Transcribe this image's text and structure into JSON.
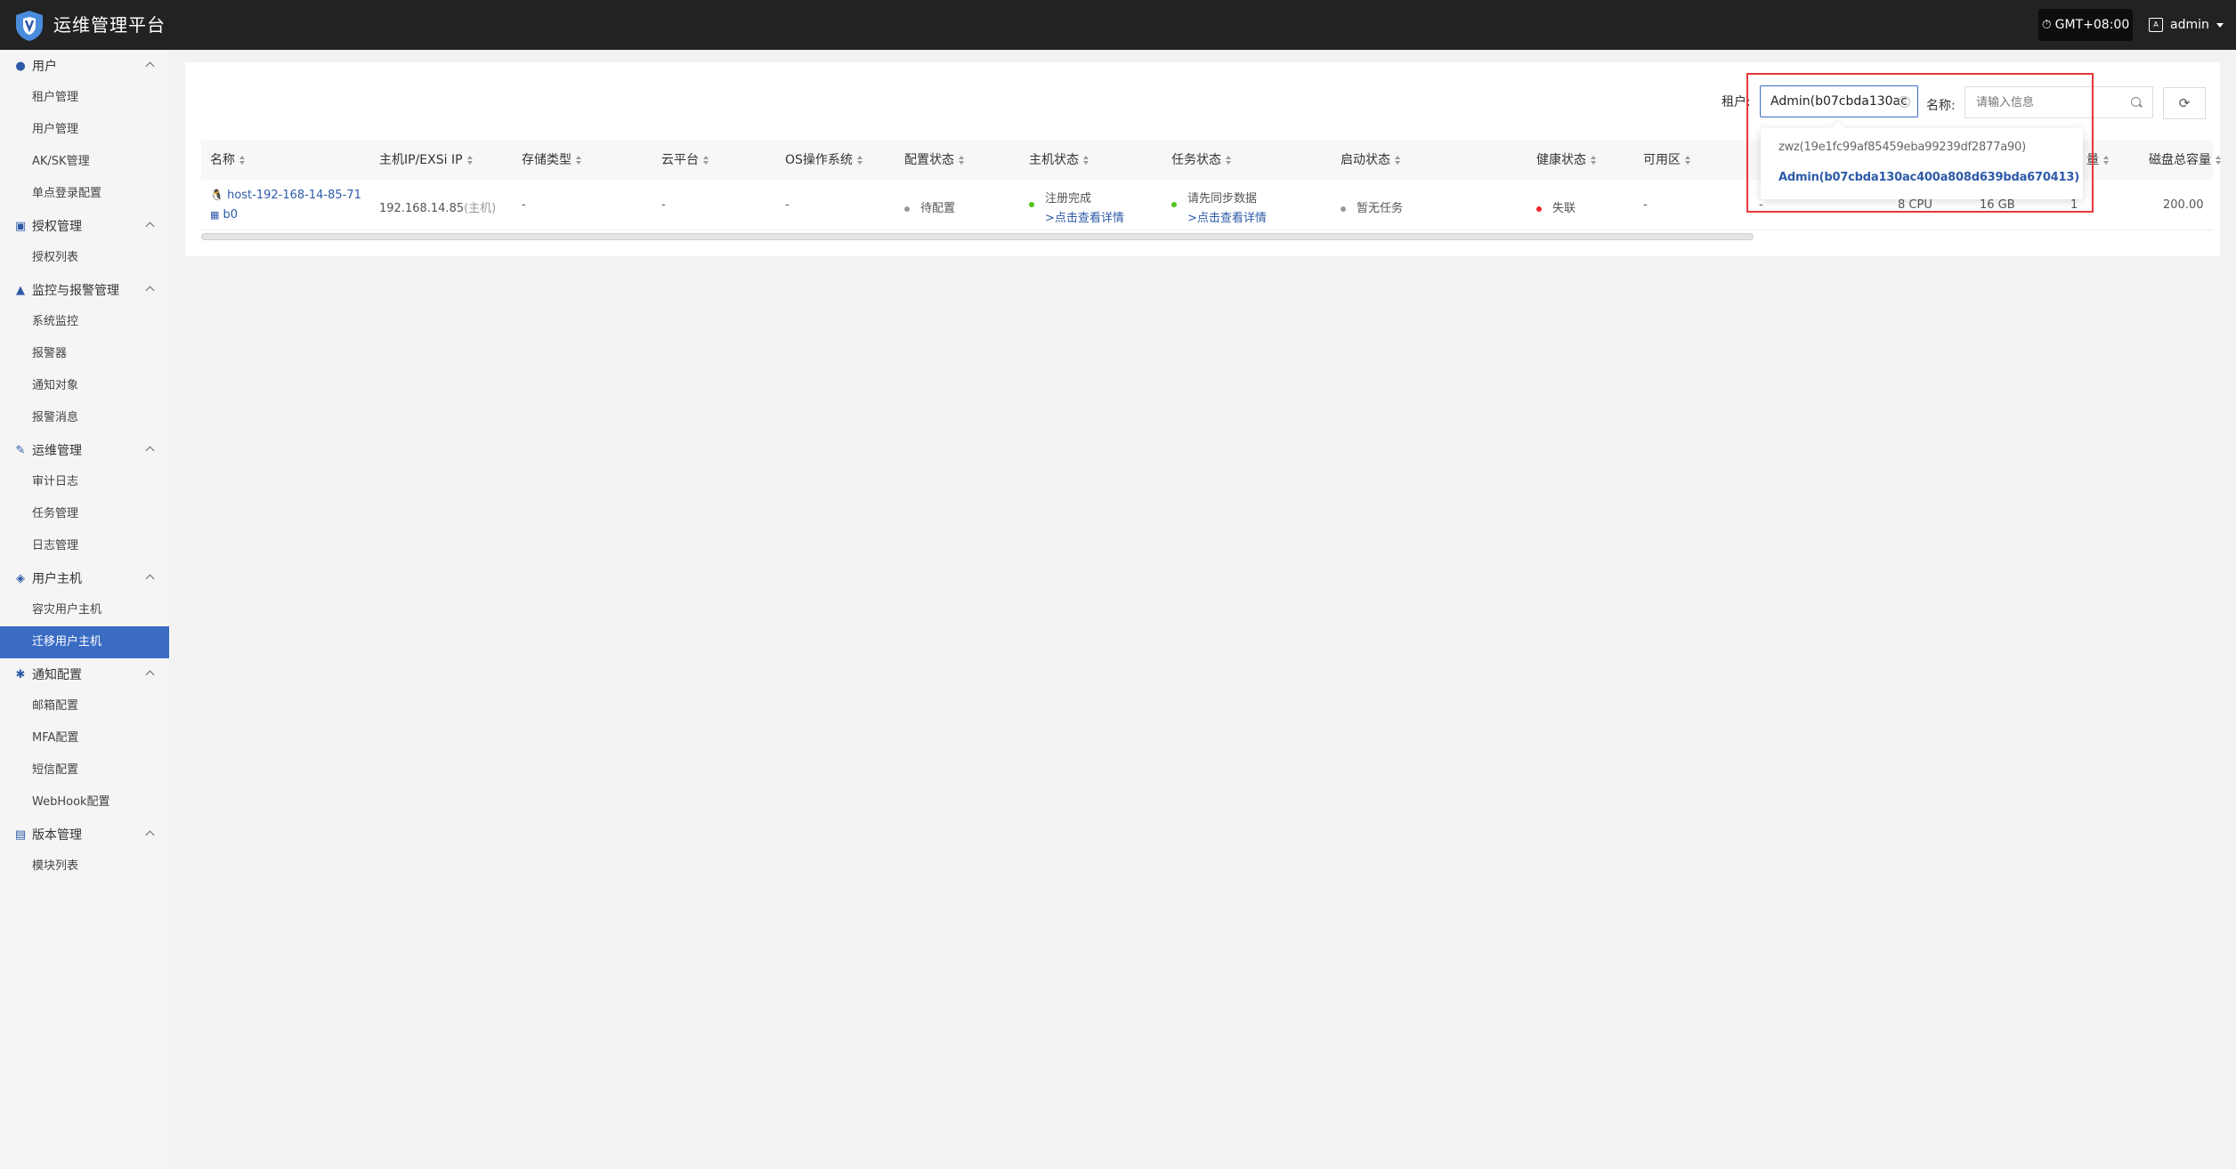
{
  "header": {
    "app_title": "运维管理平台",
    "timezone": "GMT+08:00",
    "user": "admin"
  },
  "sidebar": {
    "groups": [
      {
        "label": "用户",
        "icon": "user-icon",
        "items": [
          "租户管理",
          "用户管理",
          "AK/SK管理",
          "单点登录配置"
        ]
      },
      {
        "label": "授权管理",
        "icon": "license-icon",
        "items": [
          "授权列表"
        ]
      },
      {
        "label": "监控与报警管理",
        "icon": "alarm-icon",
        "items": [
          "系统监控",
          "报警器",
          "通知对象",
          "报警消息"
        ]
      },
      {
        "label": "运维管理",
        "icon": "tools-icon",
        "items": [
          "审计日志",
          "任务管理",
          "日志管理"
        ]
      },
      {
        "label": "用户主机",
        "icon": "layers-icon",
        "items": [
          "容灾用户主机",
          "迁移用户主机"
        ]
      },
      {
        "label": "通知配置",
        "icon": "gear-icon",
        "items": [
          "邮箱配置",
          "MFA配置",
          "短信配置",
          "WebHook配置"
        ]
      },
      {
        "label": "版本管理",
        "icon": "package-icon",
        "items": [
          "模块列表"
        ]
      }
    ],
    "active_item": "迁移用户主机"
  },
  "filters": {
    "tenant_label": "租户:",
    "tenant_value": "Admin(b07cbda130ac",
    "name_label": "名称:",
    "name_placeholder": "请输入信息"
  },
  "dropdown": {
    "options": [
      {
        "label": "zwz(19e1fc99af85459eba99239df2877a90)",
        "selected": false
      },
      {
        "label": "Admin(b07cbda130ac400a808d639bda670413)",
        "selected": true
      }
    ]
  },
  "table": {
    "columns": [
      "名称",
      "主机IP/EXSi IP",
      "存储类型",
      "云平台",
      "OS操作系统",
      "配置状态",
      "主机状态",
      "任务状态",
      "启动状态",
      "健康状态",
      "可用区",
      "量",
      "磁盘总容量"
    ],
    "rows": [
      {
        "name_line1": "host-192-168-14-85-71",
        "name_line2": "b0",
        "ip": "192.168.14.85",
        "ip_note": "(主机)",
        "storage": "-",
        "cloud": "-",
        "os": "-",
        "config_status": "待配置",
        "host_status": "注册完成",
        "host_status_link": ">点击查看详情",
        "task_status": "请先同步数据",
        "task_status_link": ">点击查看详情",
        "boot_status": "暂无任务",
        "health_status": "失联",
        "zone": "-",
        "extra": "-",
        "cpu": "8 CPU",
        "memory": "16 GB",
        "count": "1",
        "disk": "200.00"
      }
    ]
  },
  "colors": {
    "topbar": "#222222",
    "accent": "#3b6cc4",
    "link": "#2d5aa8",
    "green": "#52c41a",
    "red": "#f5222d",
    "grey": "#999999",
    "highlight": "#e53935"
  }
}
